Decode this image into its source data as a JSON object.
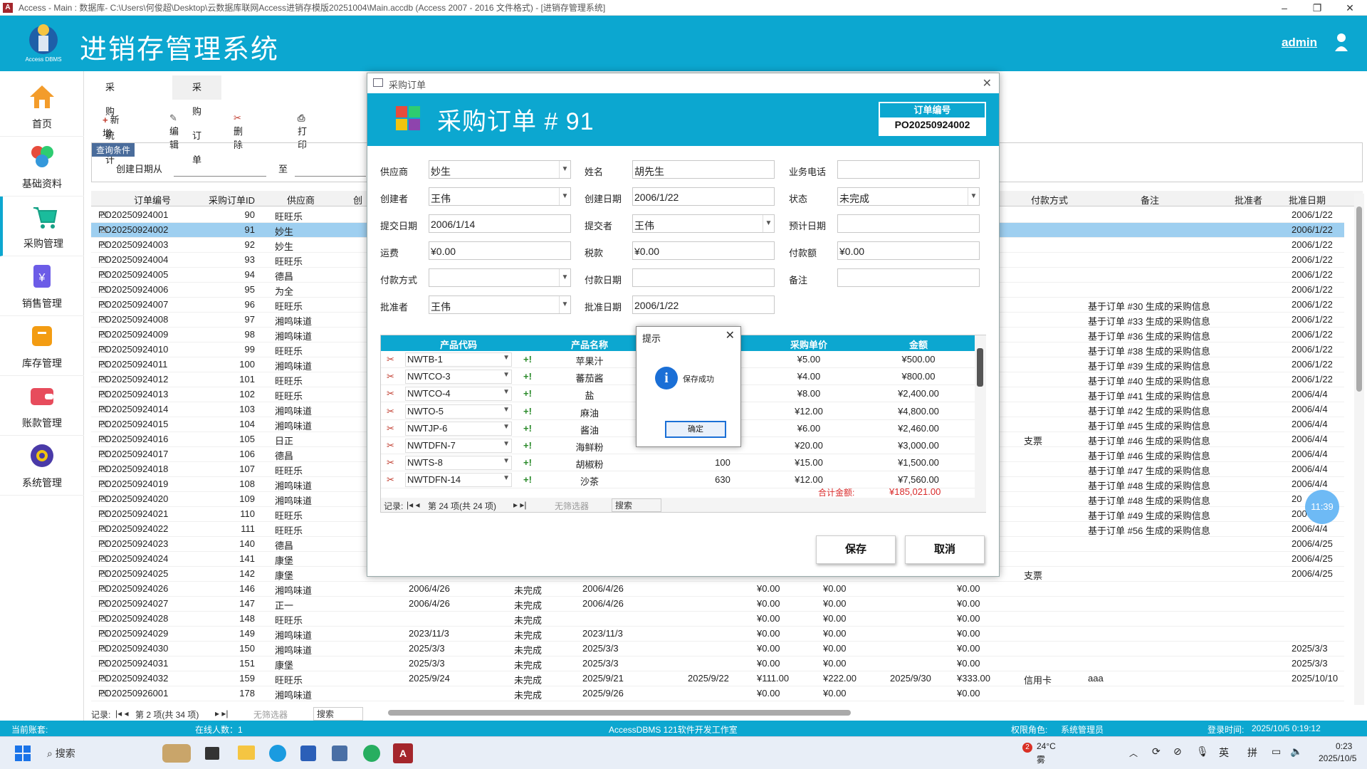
{
  "window": {
    "title": "Access - Main : 数据库- C:\\Users\\何俊超\\Desktop\\云数据库联网Access进销存模版20251004\\Main.accdb (Access 2007 - 2016 文件格式) - [进销存管理系统]",
    "app_icon": "A"
  },
  "header": {
    "title": "进销存管理系统",
    "logo_text": "Access DBMS",
    "user": "admin"
  },
  "sidebar": {
    "items": [
      {
        "label": "首页",
        "icon": "home-icon"
      },
      {
        "label": "基础资料",
        "icon": "basic-data-icon"
      },
      {
        "label": "采购管理",
        "icon": "cart-icon"
      },
      {
        "label": "销售管理",
        "icon": "sales-icon"
      },
      {
        "label": "库存管理",
        "icon": "inventory-icon"
      },
      {
        "label": "账款管理",
        "icon": "wallet-icon"
      },
      {
        "label": "系统管理",
        "icon": "gear-icon"
      }
    ]
  },
  "tabs": [
    "采购统计",
    "采购订单"
  ],
  "toolbar": {
    "add": "新增",
    "edit": "编辑",
    "delete": "删除",
    "print": "打印"
  },
  "query": {
    "label": "查询条件",
    "from": "创建日期从",
    "to": "至"
  },
  "grid": {
    "headers": [
      "订单编号",
      "采购订单ID",
      "供应商",
      "创",
      "付款方式",
      "备注",
      "批准者",
      "批准日期"
    ],
    "rows": [
      {
        "no": "PO20250924001",
        "id": "90",
        "sup": "旺旺乐",
        "c1": "",
        "c2": "",
        "c3": "",
        "c4": "",
        "c5": "",
        "c6": "",
        "c7": "",
        "c8": "",
        "pay": "",
        "note": "",
        "ad": "2006/1/22"
      },
      {
        "no": "PO20250924002",
        "id": "91",
        "sup": "妙生",
        "c1": "",
        "c2": "",
        "c3": "",
        "c4": "",
        "c5": "",
        "c6": "",
        "c7": "",
        "c8": "",
        "pay": "",
        "note": "",
        "ad": "2006/1/22"
      },
      {
        "no": "PO20250924003",
        "id": "92",
        "sup": "妙生",
        "c1": "",
        "c2": "",
        "c3": "",
        "c4": "",
        "c5": "",
        "c6": "",
        "c7": "",
        "c8": "",
        "pay": "",
        "note": "",
        "ad": "2006/1/22"
      },
      {
        "no": "PO20250924004",
        "id": "93",
        "sup": "旺旺乐",
        "c1": "",
        "c2": "",
        "c3": "",
        "c4": "",
        "c5": "",
        "c6": "",
        "c7": "",
        "c8": "",
        "pay": "",
        "note": "",
        "ad": "2006/1/22"
      },
      {
        "no": "PO20250924005",
        "id": "94",
        "sup": "德昌",
        "c1": "",
        "c2": "",
        "c3": "",
        "c4": "",
        "c5": "",
        "c6": "",
        "c7": "",
        "c8": "",
        "pay": "",
        "note": "",
        "ad": "2006/1/22"
      },
      {
        "no": "PO20250924006",
        "id": "95",
        "sup": "为全",
        "c1": "",
        "c2": "",
        "c3": "",
        "c4": "",
        "c5": "",
        "c6": "",
        "c7": "",
        "c8": "",
        "pay": "",
        "note": "",
        "ad": "2006/1/22"
      },
      {
        "no": "PO20250924007",
        "id": "96",
        "sup": "旺旺乐",
        "c1": "",
        "c2": "",
        "c3": "",
        "c4": "",
        "c5": "",
        "c6": "",
        "c7": "",
        "c8": "",
        "pay": "",
        "note": "基于订单 #30 生成的采购信息",
        "ad": "2006/1/22"
      },
      {
        "no": "PO20250924008",
        "id": "97",
        "sup": "湘鸣味道",
        "c1": "",
        "c2": "",
        "c3": "",
        "c4": "",
        "c5": "",
        "c6": "",
        "c7": "",
        "c8": "",
        "pay": "",
        "note": "基于订单 #33 生成的采购信息",
        "ad": "2006/1/22"
      },
      {
        "no": "PO20250924009",
        "id": "98",
        "sup": "湘鸣味道",
        "c1": "",
        "c2": "",
        "c3": "",
        "c4": "",
        "c5": "",
        "c6": "",
        "c7": "",
        "c8": "",
        "pay": "",
        "note": "基于订单 #36 生成的采购信息",
        "ad": "2006/1/22"
      },
      {
        "no": "PO20250924010",
        "id": "99",
        "sup": "旺旺乐",
        "c1": "",
        "c2": "",
        "c3": "",
        "c4": "",
        "c5": "",
        "c6": "",
        "c7": "",
        "c8": "",
        "pay": "",
        "note": "基于订单 #38 生成的采购信息",
        "ad": "2006/1/22"
      },
      {
        "no": "PO20250924011",
        "id": "100",
        "sup": "湘鸣味道",
        "c1": "",
        "c2": "",
        "c3": "",
        "c4": "",
        "c5": "",
        "c6": "",
        "c7": "",
        "c8": "",
        "pay": "",
        "note": "基于订单 #39 生成的采购信息",
        "ad": "2006/1/22"
      },
      {
        "no": "PO20250924012",
        "id": "101",
        "sup": "旺旺乐",
        "c1": "",
        "c2": "",
        "c3": "",
        "c4": "",
        "c5": "",
        "c6": "",
        "c7": "",
        "c8": "",
        "pay": "",
        "note": "基于订单 #40 生成的采购信息",
        "ad": "2006/1/22"
      },
      {
        "no": "PO20250924013",
        "id": "102",
        "sup": "旺旺乐",
        "c1": "",
        "c2": "",
        "c3": "",
        "c4": "",
        "c5": "",
        "c6": "",
        "c7": "",
        "c8": "",
        "pay": "",
        "note": "基于订单 #41 生成的采购信息",
        "ad": "2006/4/4"
      },
      {
        "no": "PO20250924014",
        "id": "103",
        "sup": "湘鸣味道",
        "c1": "",
        "c2": "",
        "c3": "",
        "c4": "",
        "c5": "",
        "c6": "",
        "c7": "",
        "c8": "",
        "pay": "",
        "note": "基于订单 #42 生成的采购信息",
        "ad": "2006/4/4"
      },
      {
        "no": "PO20250924015",
        "id": "104",
        "sup": "湘鸣味道",
        "c1": "",
        "c2": "",
        "c3": "",
        "c4": "",
        "c5": "",
        "c6": "",
        "c7": "",
        "c8": "",
        "pay": "",
        "note": "基于订单 #45 生成的采购信息",
        "ad": "2006/4/4"
      },
      {
        "no": "PO20250924016",
        "id": "105",
        "sup": "日正",
        "c1": "",
        "c2": "",
        "c3": "",
        "c4": "",
        "c5": "",
        "c6": "",
        "c7": "",
        "c8": "",
        "pay": "支票",
        "note": "基于订单 #46 生成的采购信息",
        "ad": "2006/4/4"
      },
      {
        "no": "PO20250924017",
        "id": "106",
        "sup": "德昌",
        "c1": "",
        "c2": "",
        "c3": "",
        "c4": "",
        "c5": "",
        "c6": "",
        "c7": "",
        "c8": "",
        "pay": "",
        "note": "基于订单 #46 生成的采购信息",
        "ad": "2006/4/4"
      },
      {
        "no": "PO20250924018",
        "id": "107",
        "sup": "旺旺乐",
        "c1": "",
        "c2": "",
        "c3": "",
        "c4": "",
        "c5": "",
        "c6": "",
        "c7": "",
        "c8": "",
        "pay": "",
        "note": "基于订单 #47 生成的采购信息",
        "ad": "2006/4/4"
      },
      {
        "no": "PO20250924019",
        "id": "108",
        "sup": "湘鸣味道",
        "c1": "",
        "c2": "",
        "c3": "",
        "c4": "",
        "c5": "",
        "c6": "",
        "c7": "",
        "c8": "",
        "pay": "",
        "note": "基于订单 #48 生成的采购信息",
        "ad": "2006/4/4"
      },
      {
        "no": "PO20250924020",
        "id": "109",
        "sup": "湘鸣味道",
        "c1": "",
        "c2": "",
        "c3": "",
        "c4": "",
        "c5": "",
        "c6": "",
        "c7": "",
        "c8": "",
        "pay": "",
        "note": "基于订单 #48 生成的采购信息",
        "ad": "20"
      },
      {
        "no": "PO20250924021",
        "id": "110",
        "sup": "旺旺乐",
        "c1": "",
        "c2": "",
        "c3": "",
        "c4": "",
        "c5": "",
        "c6": "",
        "c7": "",
        "c8": "",
        "pay": "",
        "note": "基于订单 #49 生成的采购信息",
        "ad": "200"
      },
      {
        "no": "PO20250924022",
        "id": "111",
        "sup": "旺旺乐",
        "c1": "",
        "c2": "",
        "c3": "",
        "c4": "",
        "c5": "",
        "c6": "",
        "c7": "",
        "c8": "",
        "pay": "",
        "note": "基于订单 #56 生成的采购信息",
        "ad": "2006/4/4"
      },
      {
        "no": "PO20250924023",
        "id": "140",
        "sup": "德昌",
        "c1": "",
        "c2": "",
        "c3": "",
        "c4": "",
        "c5": "",
        "c6": "",
        "c7": "",
        "c8": "",
        "pay": "",
        "note": "",
        "ad": "2006/4/25"
      },
      {
        "no": "PO20250924024",
        "id": "141",
        "sup": "康堡",
        "c1": "",
        "c2": "",
        "c3": "",
        "c4": "",
        "c5": "",
        "c6": "",
        "c7": "",
        "c8": "",
        "pay": "",
        "note": "",
        "ad": "2006/4/25"
      },
      {
        "no": "PO20250924025",
        "id": "142",
        "sup": "康堡",
        "c1": "",
        "c2": "",
        "c3": "",
        "c4": "",
        "c5": "",
        "c6": "",
        "c7": "",
        "c8": "",
        "pay": "支票",
        "note": "",
        "ad": "2006/4/25"
      },
      {
        "no": "PO20250924026",
        "id": "146",
        "sup": "湘鸣味道",
        "c1": "2006/4/26",
        "c2": "未完成",
        "c3": "2006/4/26",
        "c4": "",
        "c5": "¥0.00",
        "c6": "¥0.00",
        "c7": "",
        "c8": "¥0.00",
        "pay": "",
        "note": "",
        "ad": ""
      },
      {
        "no": "PO20250924027",
        "id": "147",
        "sup": "正一",
        "c1": "2006/4/26",
        "c2": "未完成",
        "c3": "2006/4/26",
        "c4": "",
        "c5": "¥0.00",
        "c6": "¥0.00",
        "c7": "",
        "c8": "¥0.00",
        "pay": "",
        "note": "",
        "ad": ""
      },
      {
        "no": "PO20250924028",
        "id": "148",
        "sup": "旺旺乐",
        "c1": "",
        "c2": "未完成",
        "c3": "",
        "c4": "",
        "c5": "¥0.00",
        "c6": "¥0.00",
        "c7": "",
        "c8": "¥0.00",
        "pay": "",
        "note": "",
        "ad": ""
      },
      {
        "no": "PO20250924029",
        "id": "149",
        "sup": "湘鸣味道",
        "c1": "2023/11/3",
        "c2": "未完成",
        "c3": "2023/11/3",
        "c4": "",
        "c5": "¥0.00",
        "c6": "¥0.00",
        "c7": "",
        "c8": "¥0.00",
        "pay": "",
        "note": "",
        "ad": ""
      },
      {
        "no": "PO20250924030",
        "id": "150",
        "sup": "湘鸣味道",
        "c1": "2025/3/3",
        "c2": "未完成",
        "c3": "2025/3/3",
        "c4": "",
        "c5": "¥0.00",
        "c6": "¥0.00",
        "c7": "",
        "c8": "¥0.00",
        "pay": "",
        "note": "",
        "ad": "2025/3/3"
      },
      {
        "no": "PO20250924031",
        "id": "151",
        "sup": "康堡",
        "c1": "2025/3/3",
        "c2": "未完成",
        "c3": "2025/3/3",
        "c4": "",
        "c5": "¥0.00",
        "c6": "¥0.00",
        "c7": "",
        "c8": "¥0.00",
        "pay": "",
        "note": "",
        "ad": "2025/3/3"
      },
      {
        "no": "PO20250924032",
        "id": "159",
        "sup": "旺旺乐",
        "c1": "2025/9/24",
        "c2": "未完成",
        "c3": "2025/9/21",
        "c4": "2025/9/22",
        "c5": "¥111.00",
        "c6": "¥222.00",
        "c7": "2025/9/30",
        "c8": "¥333.00",
        "pay": "信用卡",
        "note": "aaa",
        "ad": "2025/10/10"
      },
      {
        "no": "PO20250926001",
        "id": "178",
        "sup": "湘鸣味道",
        "c1": "",
        "c2": "未完成",
        "c3": "2025/9/26",
        "c4": "",
        "c5": "¥0.00",
        "c6": "¥0.00",
        "c7": "",
        "c8": "¥0.00",
        "pay": "",
        "note": "",
        "ad": ""
      }
    ],
    "nav": {
      "label": "记录:",
      "pos": "第 2 项(共 34 项)",
      "filter": "无筛选器",
      "search": "搜索"
    }
  },
  "status": {
    "account": "当前账套:",
    "online": "在线人数：1",
    "center": "AccessDBMS 121软件开发工作室",
    "role_label": "权限角色:",
    "role": "系统管理员",
    "login_label": "登录时间:",
    "login": "2025/10/5 0:19:12"
  },
  "taskbar": {
    "search": "搜索",
    "weather_badge": "2",
    "temp": "24°C",
    "weather": "雾",
    "ime1": "英",
    "ime2": "拼",
    "time": "0:23",
    "date": "2025/10/5"
  },
  "dialog": {
    "window_title": "采购订单",
    "title": "采购订单 # 91",
    "order_label": "订单编号",
    "order_no": "PO20250924002",
    "fields": {
      "supplier_l": "供应商",
      "supplier": "妙生",
      "name_l": "姓名",
      "name": "胡先生",
      "phone_l": "业务电话",
      "phone": "",
      "creator_l": "创建者",
      "creator": "王伟",
      "cdate_l": "创建日期",
      "cdate": "2006/1/22",
      "state_l": "状态",
      "state": "未完成",
      "sdate_l": "提交日期",
      "sdate": "2006/1/14",
      "submitter_l": "提交者",
      "submitter": "王伟",
      "edate_l": "预计日期",
      "edate": "",
      "freight_l": "运费",
      "freight": "¥0.00",
      "tax_l": "税款",
      "tax": "¥0.00",
      "paid_l": "付款额",
      "paid": "¥0.00",
      "paymethod_l": "付款方式",
      "paymethod": "",
      "paydate_l": "付款日期",
      "paydate": "",
      "note_l": "备注",
      "note": "",
      "approver_l": "批准者",
      "approver": "王伟",
      "adate_l": "批准日期",
      "adate": "2006/1/22"
    },
    "sub_headers": [
      "产品代码",
      "产品名称",
      "采购单价",
      "金额"
    ],
    "lines": [
      {
        "code": "NWTB-1",
        "name": "苹果汁",
        "qty": "",
        "price": "¥5.00",
        "amt": "¥500.00"
      },
      {
        "code": "NWTCO-3",
        "name": "蕃茄酱",
        "qty": "",
        "price": "¥4.00",
        "amt": "¥800.00"
      },
      {
        "code": "NWTCO-4",
        "name": "盐",
        "qty": "",
        "price": "¥8.00",
        "amt": "¥2,400.00"
      },
      {
        "code": "NWTO-5",
        "name": "麻油",
        "qty": "",
        "price": "¥12.00",
        "amt": "¥4,800.00"
      },
      {
        "code": "NWTJP-6",
        "name": "酱油",
        "qty": "",
        "price": "¥6.00",
        "amt": "¥2,460.00"
      },
      {
        "code": "NWTDFN-7",
        "name": "海鲜粉",
        "qty": "",
        "price": "¥20.00",
        "amt": "¥3,000.00"
      },
      {
        "code": "NWTS-8",
        "name": "胡椒粉",
        "qty": "100",
        "price": "¥15.00",
        "amt": "¥1,500.00"
      },
      {
        "code": "NWTDFN-14",
        "name": "沙茶",
        "qty": "630",
        "price": "¥12.00",
        "amt": "¥7,560.00"
      }
    ],
    "total_label": "合计金额:",
    "total": "¥185,021.00",
    "sub_nav": {
      "label": "记录:",
      "pos": "第 24 项(共 24 项)",
      "filter": "无筛选器",
      "search": "搜索"
    },
    "save": "保存",
    "cancel": "取消"
  },
  "msgbox": {
    "title": "提示",
    "message": "保存成功",
    "ok": "确定"
  },
  "overlay_clock": "11:39",
  "colors": {
    "accent": "#0ca7d0",
    "selected_row": "#9ecff0",
    "total_red": "#d92a2a"
  }
}
